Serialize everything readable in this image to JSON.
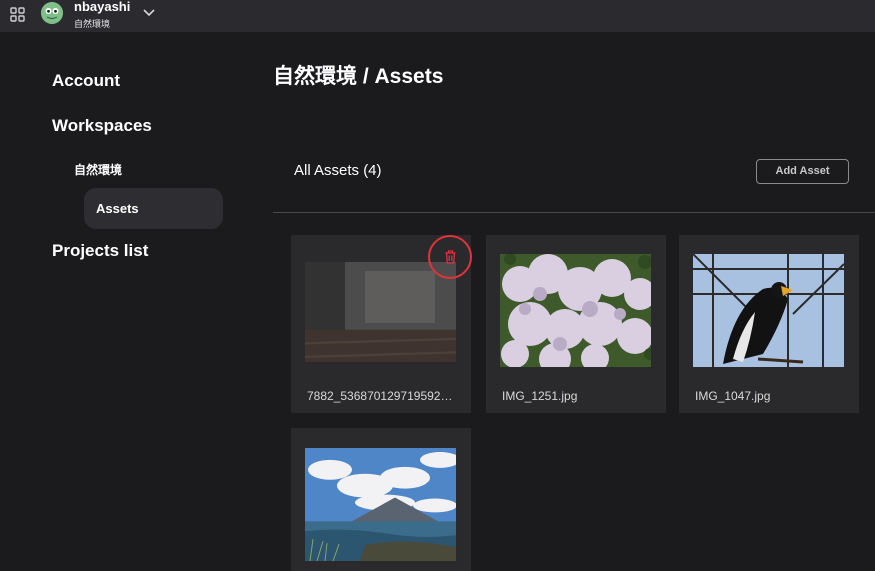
{
  "header": {
    "user_name": "nbayashi",
    "org_name": "自然環境",
    "icons": {
      "apps": "grid-icon",
      "avatar": "frog-avatar",
      "menu": "chevron-down-icon"
    }
  },
  "sidebar": {
    "account": "Account",
    "workspaces": "Workspaces",
    "workspace_name": "自然環境",
    "assets": "Assets",
    "projects": "Projects list"
  },
  "main": {
    "page_title": "自然環境 / Assets",
    "section_title": "All Assets (4)",
    "add_asset_label": "Add Asset",
    "assets": [
      {
        "name": "7882_536870129719592…",
        "thumbnail": "room-interior-faded"
      },
      {
        "name": "IMG_1251.jpg",
        "thumbnail": "lilac-flowers"
      },
      {
        "name": "IMG_1047.jpg",
        "thumbnail": "eagle-in-cage"
      },
      {
        "name": "",
        "thumbnail": "mountain-coast-landscape"
      }
    ],
    "delete_icon": "trash-icon"
  },
  "colors": {
    "background": "#1b1b1e",
    "topbar": "#2b2b2f",
    "card": "#2a2a2d",
    "delete_accent": "#e0333a"
  }
}
